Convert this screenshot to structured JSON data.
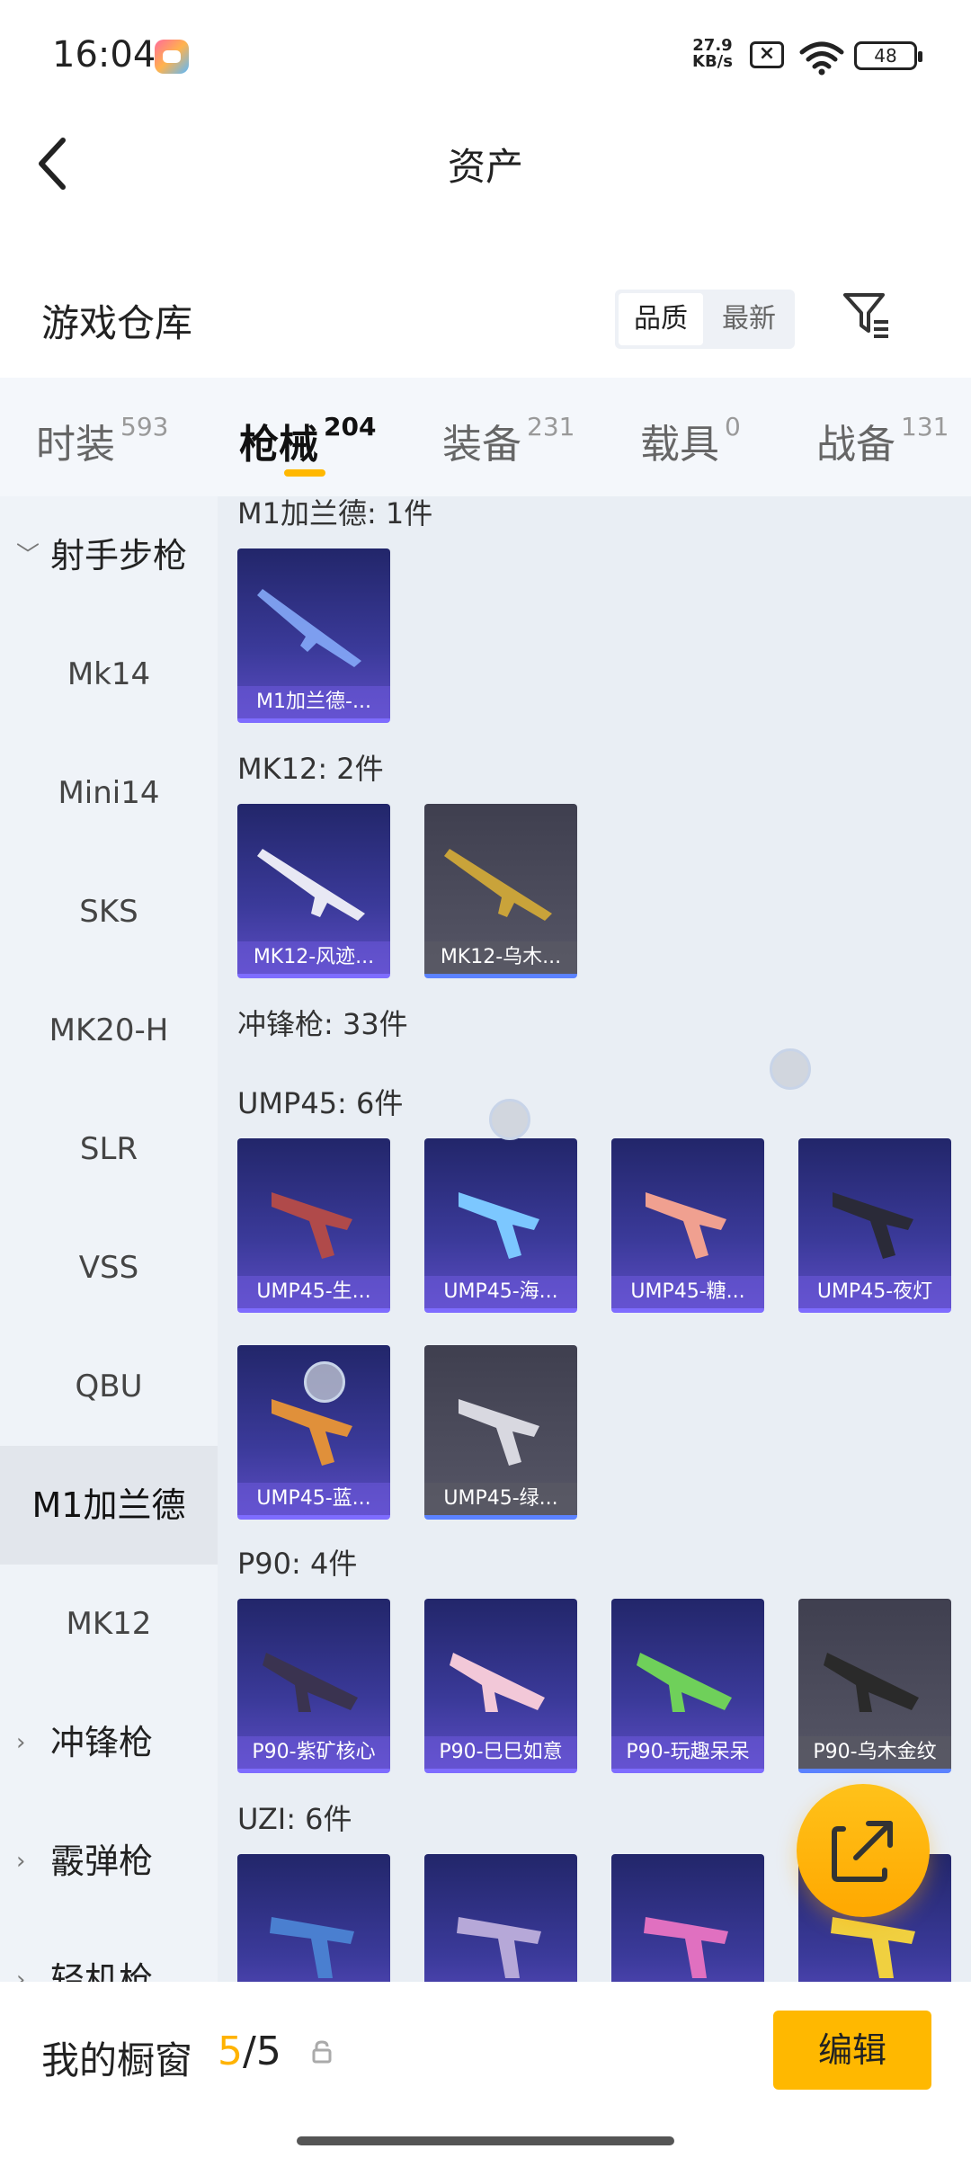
{
  "status_bar": {
    "time": "16:04",
    "net_speed_value": "27.9",
    "net_speed_unit": "KB/s",
    "battery": "48"
  },
  "header": {
    "title": "资产"
  },
  "section": {
    "title": "游戏仓库",
    "sort_quality": "品质",
    "sort_newest": "最新"
  },
  "tabs": [
    {
      "label": "时装",
      "count": "593"
    },
    {
      "label": "枪械",
      "count": "204"
    },
    {
      "label": "装备",
      "count": "231"
    },
    {
      "label": "载具",
      "count": "0"
    },
    {
      "label": "战备",
      "count": "131"
    }
  ],
  "sidebar": {
    "group_open": "射手步枪",
    "items": [
      "Mk14",
      "Mini14",
      "SKS",
      "MK20-H",
      "SLR",
      "VSS",
      "QBU",
      "M1加兰德",
      "MK12"
    ],
    "group_smg": "冲锋枪",
    "group_shotgun": "霰弹枪",
    "group_lmg": "轻机枪"
  },
  "content": {
    "m1_header": "M1加兰德: 1件",
    "m1_items": [
      "M1加兰德-..."
    ],
    "mk12_header": "MK12: 2件",
    "mk12_items": [
      "MK12-风迹...",
      "MK12-乌木..."
    ],
    "smg_header": "冲锋枪: 33件",
    "ump_header": "UMP45: 6件",
    "ump_items": [
      "UMP45-生...",
      "UMP45-海...",
      "UMP45-糖...",
      "UMP45-夜灯",
      "UMP45-蓝...",
      "UMP45-绿..."
    ],
    "p90_header": "P90: 4件",
    "p90_items": [
      "P90-紫矿核心",
      "P90-巳巳如意",
      "P90-玩趣呆呆",
      "P90-乌木金纹"
    ],
    "uzi_header": "UZI: 6件"
  },
  "bottom": {
    "label": "我的橱窗",
    "current": "5",
    "total": "/5",
    "edit": "编辑"
  },
  "colors": {
    "accent": "#ffb800",
    "card_purple": "#3b3a9a",
    "card_gray": "#565666"
  }
}
